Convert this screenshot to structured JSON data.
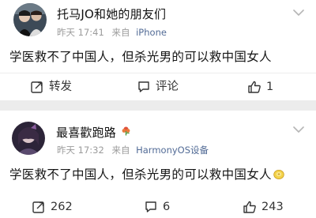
{
  "posts": [
    {
      "username": "托马JO和她的朋友们",
      "time": "昨天 17:41",
      "source_prefix": "来自",
      "source": "iPhone",
      "text": "学医救不了中国人，但杀光男的可以救中国女人",
      "actions": {
        "repost": "转发",
        "comment": "评论",
        "like": "1"
      },
      "icons": {
        "avatar": "user-avatar",
        "menu": "chevron-down-icon"
      }
    },
    {
      "username": "最喜歡跑路",
      "time": "昨天 17:32",
      "source_prefix": "来自",
      "source": "HarmonyOS设备",
      "text": "学医救不了中国人，但杀光男的可以救中国女人",
      "actions": {
        "repost": "262",
        "comment": "6",
        "like": "243"
      },
      "icons": {
        "avatar": "user-avatar",
        "badge": "flower-badge-icon",
        "emoji": "money-emoji-icon",
        "menu": "chevron-down-icon"
      }
    }
  ],
  "colors": {
    "background": "#ececec",
    "card": "#ffffff",
    "meta": "#9b9b9b",
    "source": "#526b96"
  }
}
